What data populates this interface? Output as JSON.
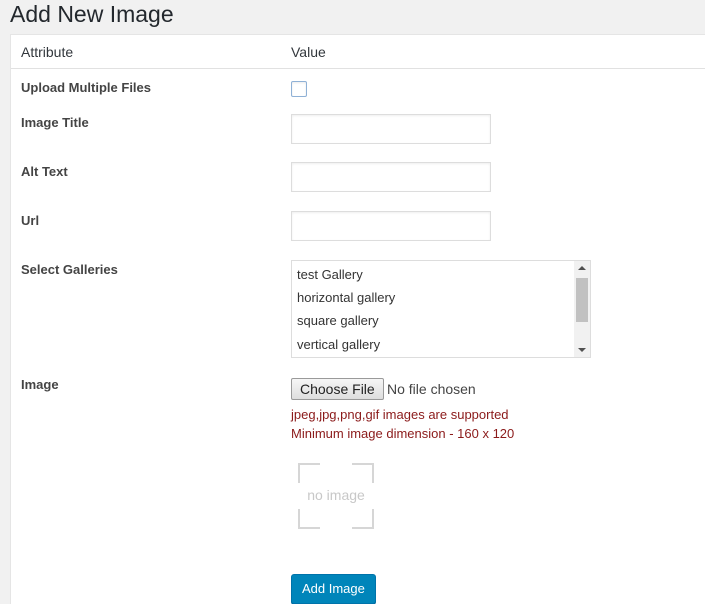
{
  "page": {
    "title": "Add New Image"
  },
  "table": {
    "col_attribute": "Attribute",
    "col_value": "Value"
  },
  "fields": {
    "upload_multiple_label": "Upload Multiple Files",
    "upload_multiple_checked": false,
    "image_title_label": "Image Title",
    "image_title_value": "",
    "alt_text_label": "Alt Text",
    "alt_text_value": "",
    "url_label": "Url",
    "url_value": "",
    "galleries_label": "Select Galleries",
    "galleries": [
      "test Gallery",
      "horizontal gallery",
      "square gallery",
      "vertical gallery"
    ],
    "image_label": "Image",
    "choose_file_label": "Choose File",
    "no_file_text": "No file chosen",
    "hint_formats": "jpeg,jpg,png,gif images are supported",
    "hint_dimension": "Minimum image dimension - 160 x 120",
    "no_image_text": "no image"
  },
  "actions": {
    "add_image_label": "Add Image"
  },
  "colors": {
    "primary_button": "#0085ba",
    "hint_text": "#8b1a1a"
  },
  "icons": {
    "image_placeholder": "image-placeholder-icon"
  }
}
